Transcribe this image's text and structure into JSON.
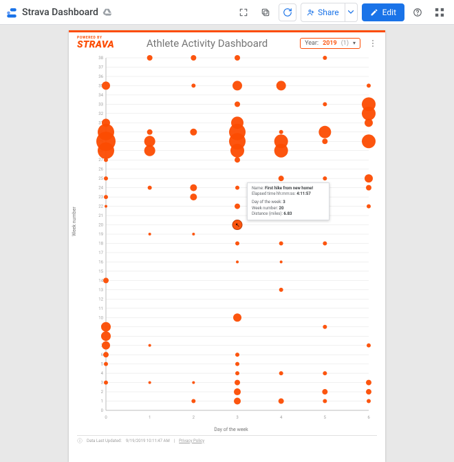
{
  "appbar": {
    "title": "Strava Dashboard",
    "share_label": "Share",
    "edit_label": "Edit"
  },
  "report": {
    "powered_by": "POWERED BY",
    "brand": "STRAVA",
    "title": "Athlete Activity Dashboard",
    "filter_label": "Year:",
    "filter_value": "2019",
    "filter_count": "(1)",
    "footer_prefix": "Data Last Updated:",
    "footer_time": "9/19/2019 10:11:47 AM",
    "footer_privacy": "Privacy Policy"
  },
  "tooltip": {
    "name_label": "Name:",
    "name_value": "First hike from new home!",
    "elapsed_label": "Elapsed time hh:mm:ss:",
    "elapsed_value": "4:11:57",
    "day_label": "Day of the week:",
    "day_value": "3",
    "week_label": "Week number:",
    "week_value": "20",
    "dist_label": "Distance (miles):",
    "dist_value": "6.83"
  },
  "chart_data": {
    "type": "scatter",
    "title": "Athlete Activity Dashboard",
    "xlabel": "Day of the week",
    "ylabel": "Week number",
    "xlim": [
      0,
      6
    ],
    "ylim": [
      0,
      38
    ],
    "size_field": "distance_miles",
    "tooltip_point": {
      "x": 3,
      "y": 20,
      "size": 6.83,
      "name": "First hike from new home!",
      "elapsed": "4:11:57"
    },
    "points": [
      {
        "x": 0,
        "y": 35,
        "size": 6
      },
      {
        "x": 0,
        "y": 31,
        "size": 6
      },
      {
        "x": 0,
        "y": 30,
        "size": 12
      },
      {
        "x": 0,
        "y": 29,
        "size": 14
      },
      {
        "x": 0,
        "y": 28,
        "size": 12
      },
      {
        "x": 0,
        "y": 27,
        "size": 3
      },
      {
        "x": 0,
        "y": 25,
        "size": 3
      },
      {
        "x": 0,
        "y": 23,
        "size": 3
      },
      {
        "x": 0,
        "y": 22,
        "size": 2
      },
      {
        "x": 0,
        "y": 14,
        "size": 4
      },
      {
        "x": 0,
        "y": 9,
        "size": 7
      },
      {
        "x": 0,
        "y": 8,
        "size": 7
      },
      {
        "x": 0,
        "y": 7,
        "size": 6
      },
      {
        "x": 0,
        "y": 6,
        "size": 4
      },
      {
        "x": 0,
        "y": 5,
        "size": 3
      },
      {
        "x": 0,
        "y": 3,
        "size": 3
      },
      {
        "x": 1,
        "y": 38,
        "size": 4
      },
      {
        "x": 1,
        "y": 30,
        "size": 4
      },
      {
        "x": 1,
        "y": 29,
        "size": 8
      },
      {
        "x": 1,
        "y": 28,
        "size": 8
      },
      {
        "x": 1,
        "y": 24,
        "size": 3
      },
      {
        "x": 1,
        "y": 19,
        "size": 2
      },
      {
        "x": 1,
        "y": 7,
        "size": 2
      },
      {
        "x": 1,
        "y": 3,
        "size": 2
      },
      {
        "x": 2,
        "y": 38,
        "size": 4
      },
      {
        "x": 2,
        "y": 35,
        "size": 3
      },
      {
        "x": 2,
        "y": 30,
        "size": 5
      },
      {
        "x": 2,
        "y": 24,
        "size": 5
      },
      {
        "x": 2,
        "y": 23,
        "size": 5
      },
      {
        "x": 2,
        "y": 19,
        "size": 2
      },
      {
        "x": 2,
        "y": 3,
        "size": 2
      },
      {
        "x": 2,
        "y": 1,
        "size": 3
      },
      {
        "x": 3,
        "y": 38,
        "size": 4
      },
      {
        "x": 3,
        "y": 35,
        "size": 7
      },
      {
        "x": 3,
        "y": 33,
        "size": 4
      },
      {
        "x": 3,
        "y": 31,
        "size": 9
      },
      {
        "x": 3,
        "y": 30,
        "size": 12
      },
      {
        "x": 3,
        "y": 29,
        "size": 12
      },
      {
        "x": 3,
        "y": 28,
        "size": 10
      },
      {
        "x": 3,
        "y": 27,
        "size": 4
      },
      {
        "x": 3,
        "y": 24,
        "size": 3
      },
      {
        "x": 3,
        "y": 22,
        "size": 4
      },
      {
        "x": 3,
        "y": 20,
        "size": 7
      },
      {
        "x": 3,
        "y": 18,
        "size": 3
      },
      {
        "x": 3,
        "y": 16,
        "size": 2
      },
      {
        "x": 3,
        "y": 10,
        "size": 6
      },
      {
        "x": 3,
        "y": 6,
        "size": 3
      },
      {
        "x": 3,
        "y": 5,
        "size": 3
      },
      {
        "x": 3,
        "y": 4,
        "size": 3
      },
      {
        "x": 3,
        "y": 3,
        "size": 4
      },
      {
        "x": 3,
        "y": 2,
        "size": 5
      },
      {
        "x": 3,
        "y": 1,
        "size": 5
      },
      {
        "x": 4,
        "y": 35,
        "size": 7
      },
      {
        "x": 4,
        "y": 30,
        "size": 3
      },
      {
        "x": 4,
        "y": 29,
        "size": 10
      },
      {
        "x": 4,
        "y": 28,
        "size": 10
      },
      {
        "x": 4,
        "y": 25,
        "size": 4
      },
      {
        "x": 4,
        "y": 24,
        "size": 3
      },
      {
        "x": 4,
        "y": 22,
        "size": 6
      },
      {
        "x": 4,
        "y": 18,
        "size": 3
      },
      {
        "x": 4,
        "y": 16,
        "size": 2
      },
      {
        "x": 4,
        "y": 13,
        "size": 3
      },
      {
        "x": 4,
        "y": 4,
        "size": 3
      },
      {
        "x": 4,
        "y": 1,
        "size": 4
      },
      {
        "x": 5,
        "y": 38,
        "size": 3
      },
      {
        "x": 5,
        "y": 33,
        "size": 3
      },
      {
        "x": 5,
        "y": 30,
        "size": 9
      },
      {
        "x": 5,
        "y": 29,
        "size": 4
      },
      {
        "x": 5,
        "y": 25,
        "size": 3
      },
      {
        "x": 5,
        "y": 24,
        "size": 3
      },
      {
        "x": 5,
        "y": 22,
        "size": 3
      },
      {
        "x": 5,
        "y": 18,
        "size": 3
      },
      {
        "x": 5,
        "y": 9,
        "size": 3
      },
      {
        "x": 5,
        "y": 4,
        "size": 3
      },
      {
        "x": 5,
        "y": 2,
        "size": 4
      },
      {
        "x": 5,
        "y": 1,
        "size": 3
      },
      {
        "x": 6,
        "y": 35,
        "size": 3
      },
      {
        "x": 6,
        "y": 33,
        "size": 10
      },
      {
        "x": 6,
        "y": 32,
        "size": 10
      },
      {
        "x": 6,
        "y": 31,
        "size": 6
      },
      {
        "x": 6,
        "y": 29,
        "size": 10
      },
      {
        "x": 6,
        "y": 25,
        "size": 6
      },
      {
        "x": 6,
        "y": 24,
        "size": 4
      },
      {
        "x": 6,
        "y": 22,
        "size": 3
      },
      {
        "x": 6,
        "y": 7,
        "size": 3
      },
      {
        "x": 6,
        "y": 3,
        "size": 4
      },
      {
        "x": 6,
        "y": 2,
        "size": 4
      },
      {
        "x": 6,
        "y": 1,
        "size": 3
      }
    ]
  }
}
